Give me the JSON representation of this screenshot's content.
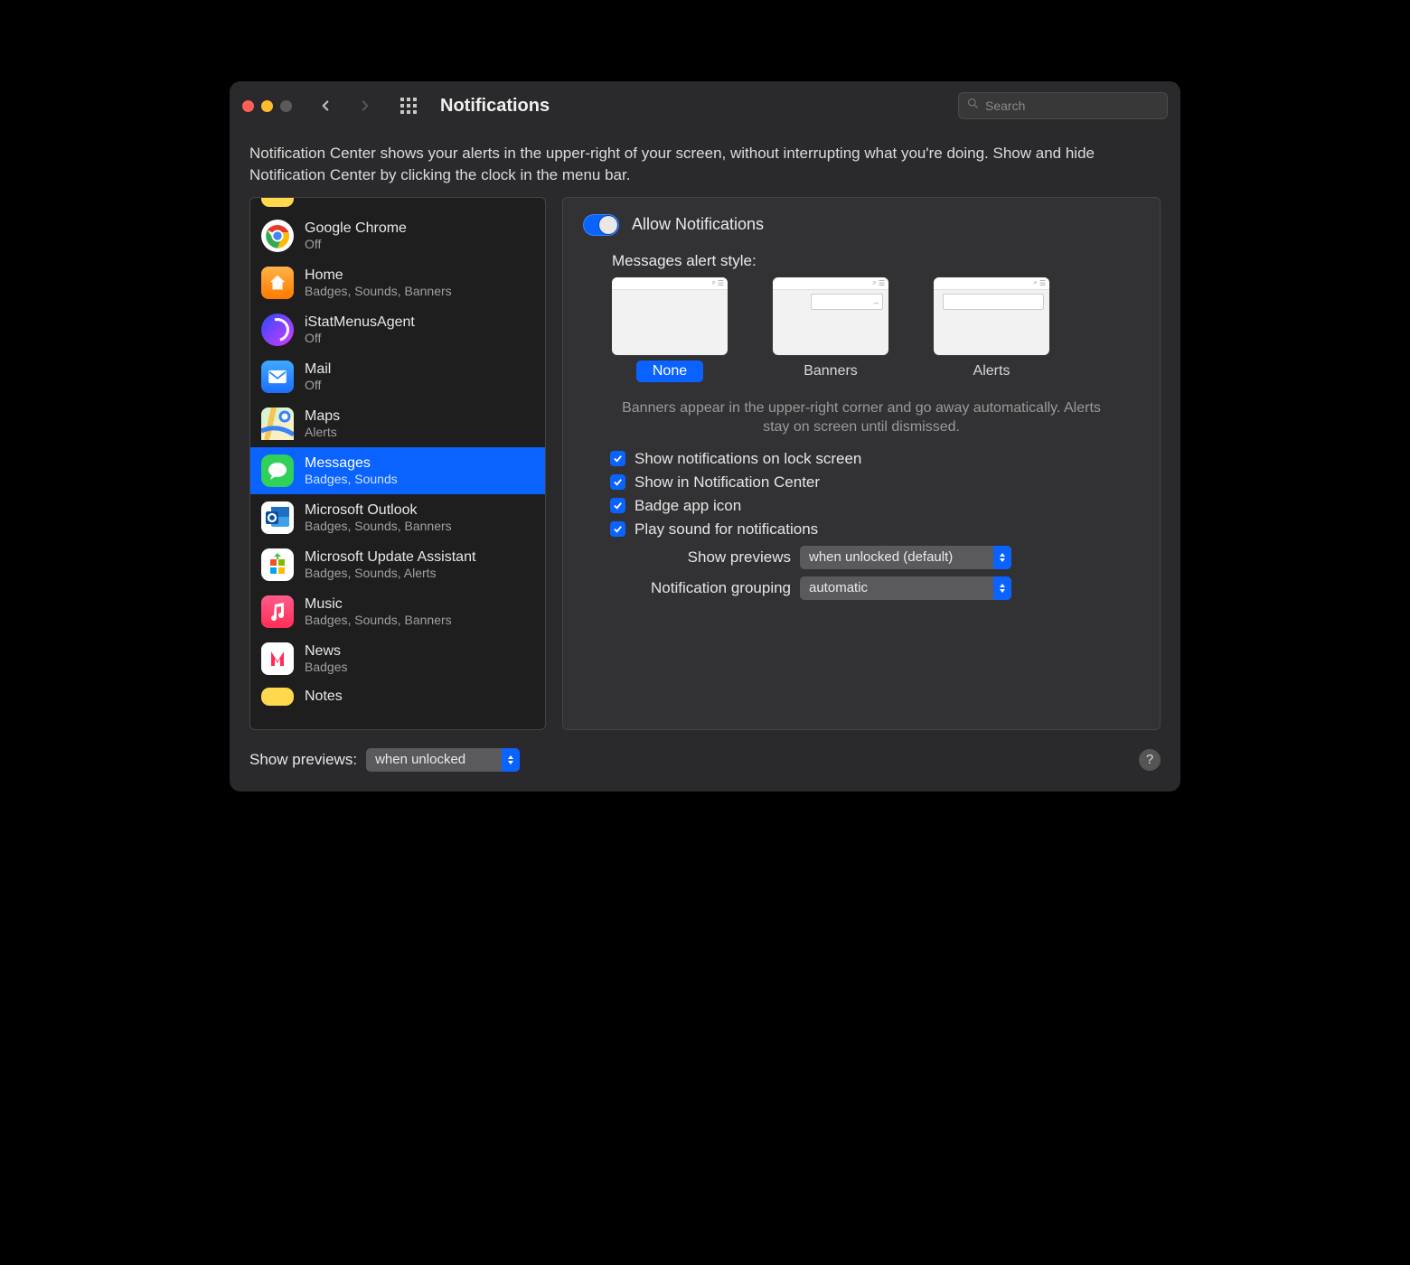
{
  "header": {
    "title": "Notifications",
    "search_placeholder": "Search"
  },
  "description": "Notification Center shows your alerts in the upper-right of your screen, without interrupting what you're doing. Show and hide Notification Center by clicking the clock in the menu bar.",
  "apps": [
    {
      "name": "Google Chrome",
      "sub": "Off"
    },
    {
      "name": "Home",
      "sub": "Badges, Sounds, Banners"
    },
    {
      "name": "iStatMenusAgent",
      "sub": "Off"
    },
    {
      "name": "Mail",
      "sub": "Off"
    },
    {
      "name": "Maps",
      "sub": "Alerts"
    },
    {
      "name": "Messages",
      "sub": "Badges, Sounds"
    },
    {
      "name": "Microsoft Outlook",
      "sub": "Badges, Sounds, Banners"
    },
    {
      "name": "Microsoft Update Assistant",
      "sub": "Badges, Sounds, Alerts"
    },
    {
      "name": "Music",
      "sub": "Badges, Sounds, Banners"
    },
    {
      "name": "News",
      "sub": "Badges"
    },
    {
      "name": "Notes",
      "sub": ""
    }
  ],
  "detail": {
    "allow_label": "Allow Notifications",
    "style_heading": "Messages alert style:",
    "styles": {
      "none": "None",
      "banners": "Banners",
      "alerts": "Alerts"
    },
    "style_help": "Banners appear in the upper-right corner and go away automatically. Alerts stay on screen until dismissed.",
    "checks": {
      "lock": "Show notifications on lock screen",
      "center": "Show in Notification Center",
      "badge": "Badge app icon",
      "sound": "Play sound for notifications"
    },
    "selects": {
      "previews_label": "Show previews",
      "previews_value": "when unlocked (default)",
      "grouping_label": "Notification grouping",
      "grouping_value": "automatic"
    }
  },
  "footer": {
    "label": "Show previews:",
    "value": "when unlocked"
  }
}
